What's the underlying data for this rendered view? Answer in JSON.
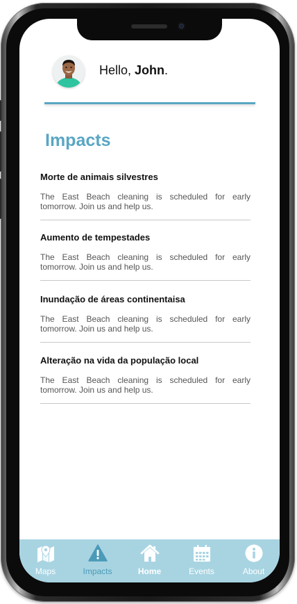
{
  "header": {
    "greeting_prefix": "Hello,",
    "user_name": "John",
    "greeting_suffix": "."
  },
  "page": {
    "title": "Impacts"
  },
  "impacts": [
    {
      "title": "Morte de animais silvestres",
      "text": "The East Beach cleaning is scheduled for early tomorrow. Join us and help us."
    },
    {
      "title": "Aumento de tempestades",
      "text": "The East Beach cleaning is scheduled for early tomorrow. Join us and help us."
    },
    {
      "title": "Inundação de áreas continentaisa",
      "text": "The East Beach cleaning is scheduled for early tomorrow. Join us and help us."
    },
    {
      "title": "Alteração na vida da população local",
      "text": "The East Beach cleaning is scheduled for early tomorrow. Join us and help us."
    }
  ],
  "nav": {
    "items": [
      {
        "label": "Maps",
        "icon": "map-icon"
      },
      {
        "label": "Impacts",
        "icon": "warning-icon"
      },
      {
        "label": "Home",
        "icon": "home-icon"
      },
      {
        "label": "Events",
        "icon": "calendar-icon"
      },
      {
        "label": "About",
        "icon": "info-icon"
      }
    ],
    "active": "Impacts"
  },
  "colors": {
    "accent": "#5aa6c4",
    "nav_background": "#a8d4e2",
    "nav_active": "#4a9ab8"
  }
}
